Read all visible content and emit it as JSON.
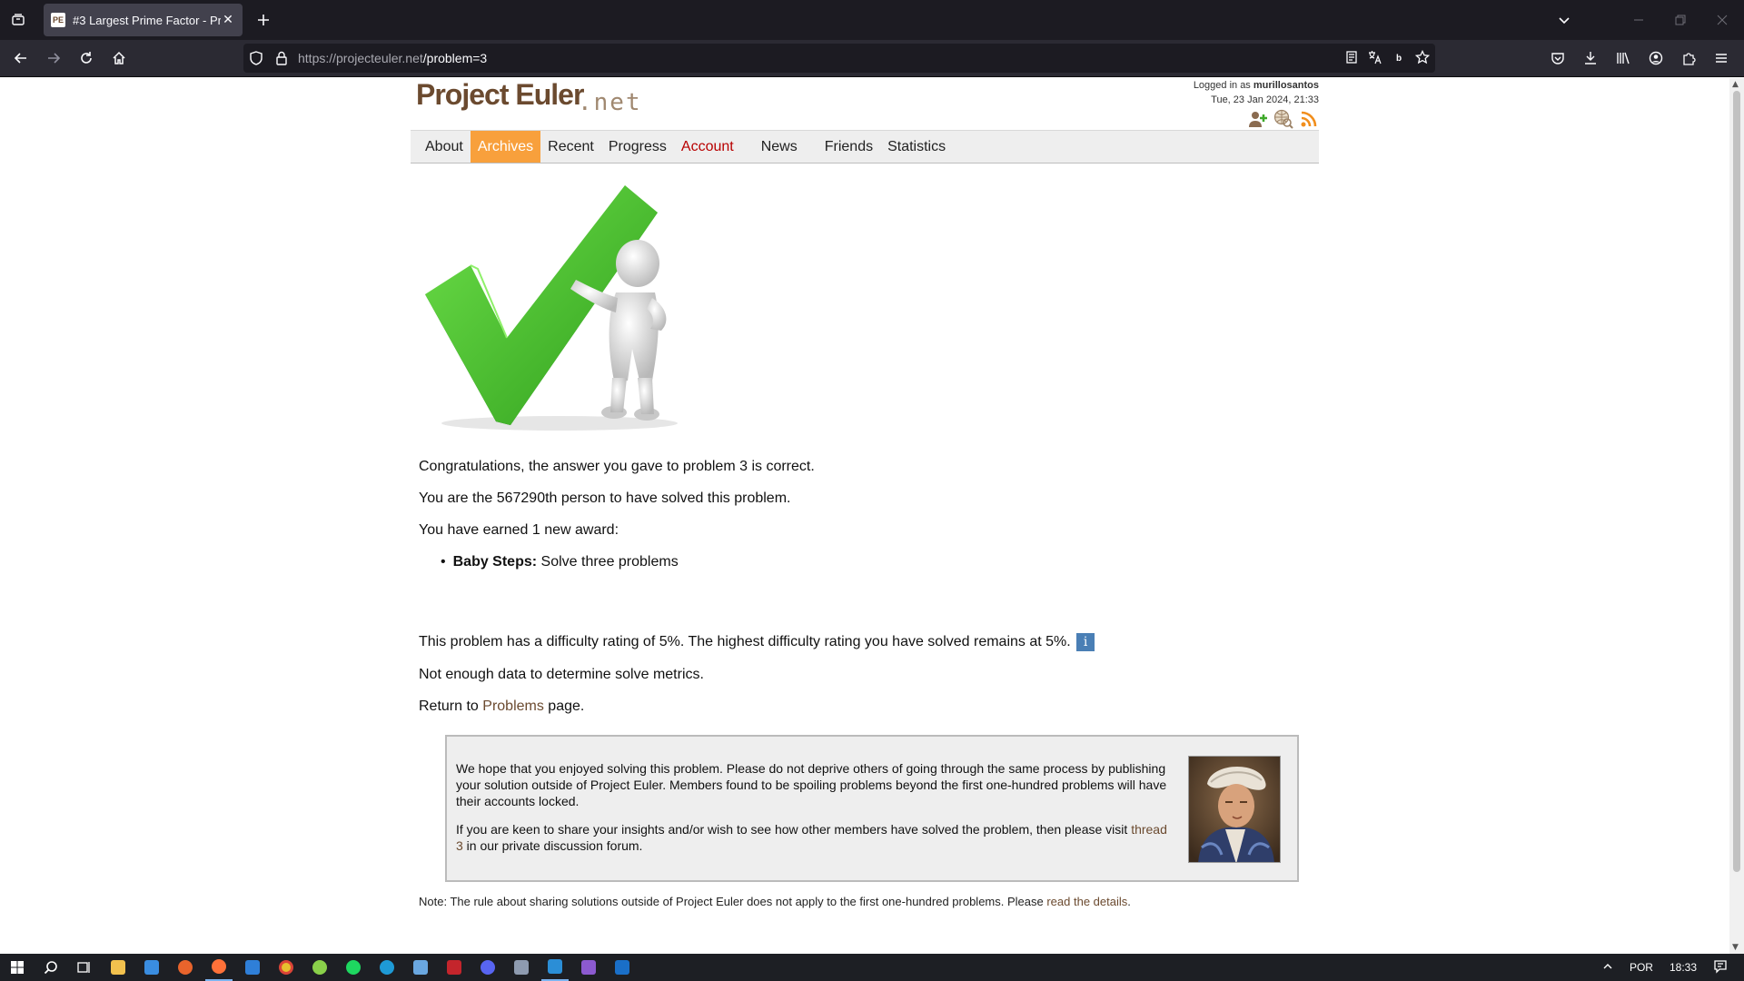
{
  "browser": {
    "tab_favicon": "PE",
    "tab_title": "#3 Largest Prime Factor - Proje",
    "url_host": "https://projecteuler.net",
    "url_path": "/problem=3",
    "icons": [
      "tabs-list-icon",
      "close-icon",
      "new-tab-icon",
      "chevron-down-icon",
      "minimize-icon",
      "restore-icon",
      "window-close-icon",
      "back-icon",
      "forward-icon",
      "reload-icon",
      "home-icon",
      "shield-icon",
      "lock-icon",
      "reader-view-icon",
      "translate-icon",
      "extension-b-icon",
      "bookmark-star-icon",
      "pocket-icon",
      "download-icon",
      "library-icon",
      "account-icon",
      "extensions-icon",
      "menu-icon"
    ]
  },
  "site": {
    "logo_main": "Project Euler",
    "logo_net": ".net",
    "logged_in_prefix": "Logged in as ",
    "username": "murillosantos",
    "datetime": "Tue, 23 Jan 2024, 21:33"
  },
  "menu": [
    {
      "label": "About"
    },
    {
      "label": "Archives"
    },
    {
      "label": "Recent"
    },
    {
      "label": "Progress"
    },
    {
      "label": "Account"
    },
    {
      "label": "News"
    },
    {
      "label": "Friends"
    },
    {
      "label": "Statistics"
    }
  ],
  "result": {
    "congrats": "Congratulations, the answer you gave to problem 3 is correct.",
    "solver_rank": "You are the 567290th person to have solved this problem.",
    "award_intro": "You have earned 1 new award:",
    "award_name": "Baby Steps:",
    "award_desc": " Solve three problems",
    "difficulty": "This problem has a difficulty rating of 5%. The highest difficulty rating you have solved remains at 5%.",
    "info_icon": "i",
    "metrics": "Not enough data to determine solve metrics.",
    "return_prefix": "Return to ",
    "return_link": "Problems",
    "return_suffix": " page."
  },
  "notice": {
    "p1": "We hope that you enjoyed solving this problem. Please do not deprive others of going through the same process by publishing your solution outside of Project Euler. Members found to be spoiling problems beyond the first one-hundred problems will have their accounts locked.",
    "p2_prefix": "If you are keen to share your insights and/or wish to see how other members have solved the problem, then please visit ",
    "p2_link": "thread 3",
    "p2_suffix": " in our private discussion forum."
  },
  "footnote": {
    "text": "Note: The rule about sharing solutions outside of Project Euler does not apply to the first one-hundred problems. Please ",
    "link": "read the details",
    "end": "."
  },
  "taskbar": {
    "language": "POR",
    "time": "18:33"
  },
  "colors": {
    "accent_orange": "#f8a03c",
    "brand_brown": "#6b4a2f",
    "account_red": "#b80000",
    "check_green": "#3fb82a"
  }
}
